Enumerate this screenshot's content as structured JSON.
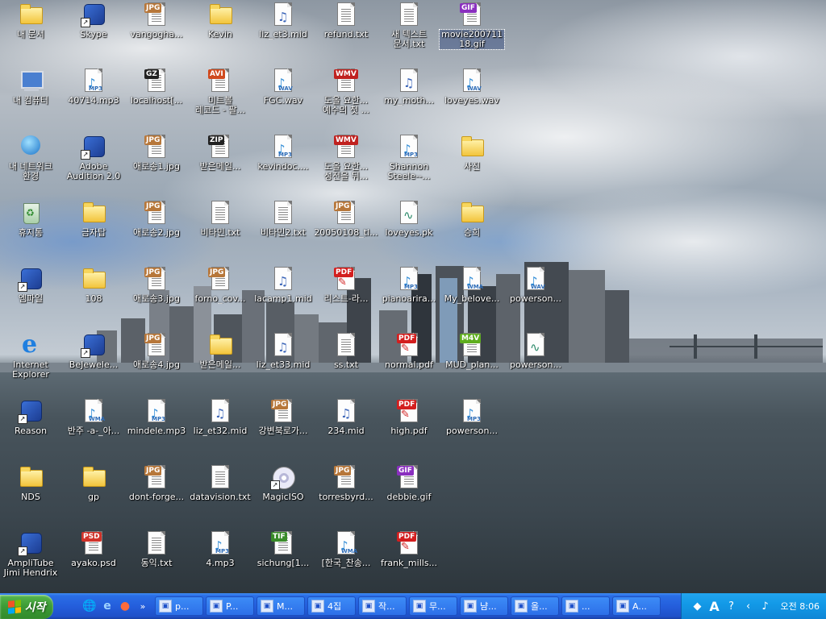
{
  "desktop": {
    "icons": [
      {
        "label": "내 문서",
        "type": "folder-special"
      },
      {
        "label": "Skype",
        "type": "app",
        "shortcut": true
      },
      {
        "label": "vangogha...",
        "type": "jpg"
      },
      {
        "label": "Kevin",
        "type": "folder"
      },
      {
        "label": "liz_et3.mid",
        "type": "mid"
      },
      {
        "label": "refund.txt",
        "type": "txt"
      },
      {
        "label": "새 텍스트\n문서.txt",
        "type": "txt"
      },
      {
        "label": "movie200711\n18.gif",
        "type": "gif",
        "selected": true
      },
      {
        "label": "내 컴퓨터",
        "type": "computer"
      },
      {
        "label": "40714.mp3",
        "type": "mp3"
      },
      {
        "label": "localhost[...",
        "type": "gz"
      },
      {
        "label": "미트볼\n레코드 - 팔...",
        "type": "avi"
      },
      {
        "label": "FGC.wav",
        "type": "wav"
      },
      {
        "label": "도올 요한...\n예수의 첫 ...",
        "type": "wmv"
      },
      {
        "label": "my_moth...",
        "type": "mid"
      },
      {
        "label": "loveyes.wav",
        "type": "wav"
      },
      {
        "label": "내 네트워크\n환경",
        "type": "network"
      },
      {
        "label": "Adobe\nAudition 2.0",
        "type": "app",
        "shortcut": true
      },
      {
        "label": "애로송1.jpg",
        "type": "jpg"
      },
      {
        "label": "받은메일...",
        "type": "zip"
      },
      {
        "label": "kevindoc....",
        "type": "mp3"
      },
      {
        "label": "도올 요한...\n성전을 뒤...",
        "type": "wmv"
      },
      {
        "label": "Shannon\nSteele--...",
        "type": "mp3"
      },
      {
        "label": "사진",
        "type": "folder"
      },
      {
        "label": "휴지통",
        "type": "recycle"
      },
      {
        "label": "금자탑",
        "type": "folder"
      },
      {
        "label": "애로송2.jpg",
        "type": "jpg"
      },
      {
        "label": "비타민.txt",
        "type": "txt"
      },
      {
        "label": "비타민2.txt",
        "type": "txt"
      },
      {
        "label": "20050108_tl...",
        "type": "jpg"
      },
      {
        "label": "loveyes.pk",
        "type": "pk"
      },
      {
        "label": "승희",
        "type": "folder"
      },
      {
        "label": "엠파일",
        "type": "app",
        "shortcut": true
      },
      {
        "label": "108",
        "type": "folder"
      },
      {
        "label": "애로송3.jpg",
        "type": "jpg"
      },
      {
        "label": "forno_cov...",
        "type": "jpg"
      },
      {
        "label": "lacamp1.mid",
        "type": "mid"
      },
      {
        "label": "리스트-라...",
        "type": "pdf"
      },
      {
        "label": "pianoarira...",
        "type": "mp3"
      },
      {
        "label": "My_belove...",
        "type": "wma"
      },
      {
        "label": "powerson...",
        "type": "wav"
      },
      {
        "label": "Internet\nExplorer",
        "type": "ie"
      },
      {
        "label": "BeJewele...",
        "type": "app",
        "shortcut": true
      },
      {
        "label": "애로송4.jpg",
        "type": "jpg"
      },
      {
        "label": "받은메일...",
        "type": "folder"
      },
      {
        "label": "liz_et33.mid",
        "type": "mid"
      },
      {
        "label": "ss.txt",
        "type": "txt"
      },
      {
        "label": "normal.pdf",
        "type": "pdf"
      },
      {
        "label": "MUD_plan...",
        "type": "m4v"
      },
      {
        "label": "powerson...",
        "type": "pk"
      },
      {
        "label": "Reason",
        "type": "app",
        "shortcut": true
      },
      {
        "label": "반주 -a-_아...",
        "type": "wma"
      },
      {
        "label": "mindele.mp3",
        "type": "mp3"
      },
      {
        "label": "liz_et32.mid",
        "type": "mid"
      },
      {
        "label": "강변북로가...",
        "type": "jpg"
      },
      {
        "label": "234.mid",
        "type": "mid"
      },
      {
        "label": "high.pdf",
        "type": "pdf"
      },
      {
        "label": "powerson...",
        "type": "mp3"
      },
      {
        "label": "NDS",
        "type": "folder"
      },
      {
        "label": "gp",
        "type": "folder"
      },
      {
        "label": "dont-forge...",
        "type": "jpg"
      },
      {
        "label": "datavision.txt",
        "type": "txt"
      },
      {
        "label": "MagicISO",
        "type": "disc",
        "shortcut": true
      },
      {
        "label": "torresbyrd...",
        "type": "jpg"
      },
      {
        "label": "debbie.gif",
        "type": "gif"
      },
      {
        "label": "AmpliTube\nJimi Hendrix",
        "type": "app",
        "shortcut": true
      },
      {
        "label": "ayako.psd",
        "type": "psd"
      },
      {
        "label": "동익.txt",
        "type": "txt"
      },
      {
        "label": "4.mp3",
        "type": "mp3"
      },
      {
        "label": "sichung[1...",
        "type": "tif"
      },
      {
        "label": "[한국_찬송...",
        "type": "wma"
      },
      {
        "label": "frank_mills...",
        "type": "pdf"
      }
    ]
  },
  "taskbar": {
    "start_label": "시작",
    "quick_launch": [
      "desktop-icon",
      "ie-icon",
      "media-icon"
    ],
    "chevron": "»",
    "tasks": [
      {
        "label": "p..."
      },
      {
        "label": "P..."
      },
      {
        "label": "M..."
      },
      {
        "label": "4집"
      },
      {
        "label": "작..."
      },
      {
        "label": "무..."
      },
      {
        "label": "냠..."
      },
      {
        "label": "올..."
      },
      {
        "label": "..."
      },
      {
        "label": "A..."
      }
    ],
    "clock": "오전 8:06"
  },
  "colors": {
    "taskbar_blue": "#245edc",
    "start_green": "#3c9a35",
    "tray_blue": "#139ae8"
  }
}
